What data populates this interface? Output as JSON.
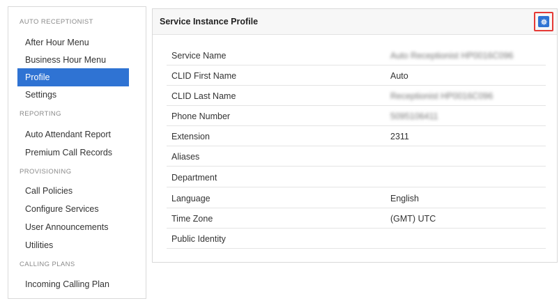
{
  "sidebar": {
    "sections": [
      {
        "header": "AUTO RECEPTIONIST",
        "items": [
          "After Hour Menu",
          "Business Hour Menu",
          "Profile",
          "Settings"
        ]
      },
      {
        "header": "REPORTING",
        "items": [
          "Auto Attendant Report",
          "Premium Call Records"
        ]
      },
      {
        "header": "PROVISIONING",
        "items": [
          "Call Policies",
          "Configure Services",
          "User Announcements",
          "Utilities"
        ]
      },
      {
        "header": "CALLING PLANS",
        "items": [
          "Incoming Calling Plan"
        ]
      }
    ],
    "active_item": "Profile"
  },
  "panel": {
    "title": "Service Instance Profile",
    "settings_icon": "gear-icon",
    "accent_color": "#2f73d3",
    "highlight_color": "#e53935",
    "fields": [
      {
        "label": "Service Name",
        "value": "Auto Receptionist HP0016C096"
      },
      {
        "label": "CLID First Name",
        "value": "Auto"
      },
      {
        "label": "CLID Last Name",
        "value": "Receptionist HP0016C096"
      },
      {
        "label": "Phone Number",
        "value": "5095106411"
      },
      {
        "label": "Extension",
        "value": "2311"
      },
      {
        "label": "Aliases",
        "value": ""
      },
      {
        "label": "Department",
        "value": ""
      },
      {
        "label": "Language",
        "value": "English"
      },
      {
        "label": "Time Zone",
        "value": "(GMT) UTC"
      },
      {
        "label": "Public Identity",
        "value": ""
      }
    ]
  }
}
